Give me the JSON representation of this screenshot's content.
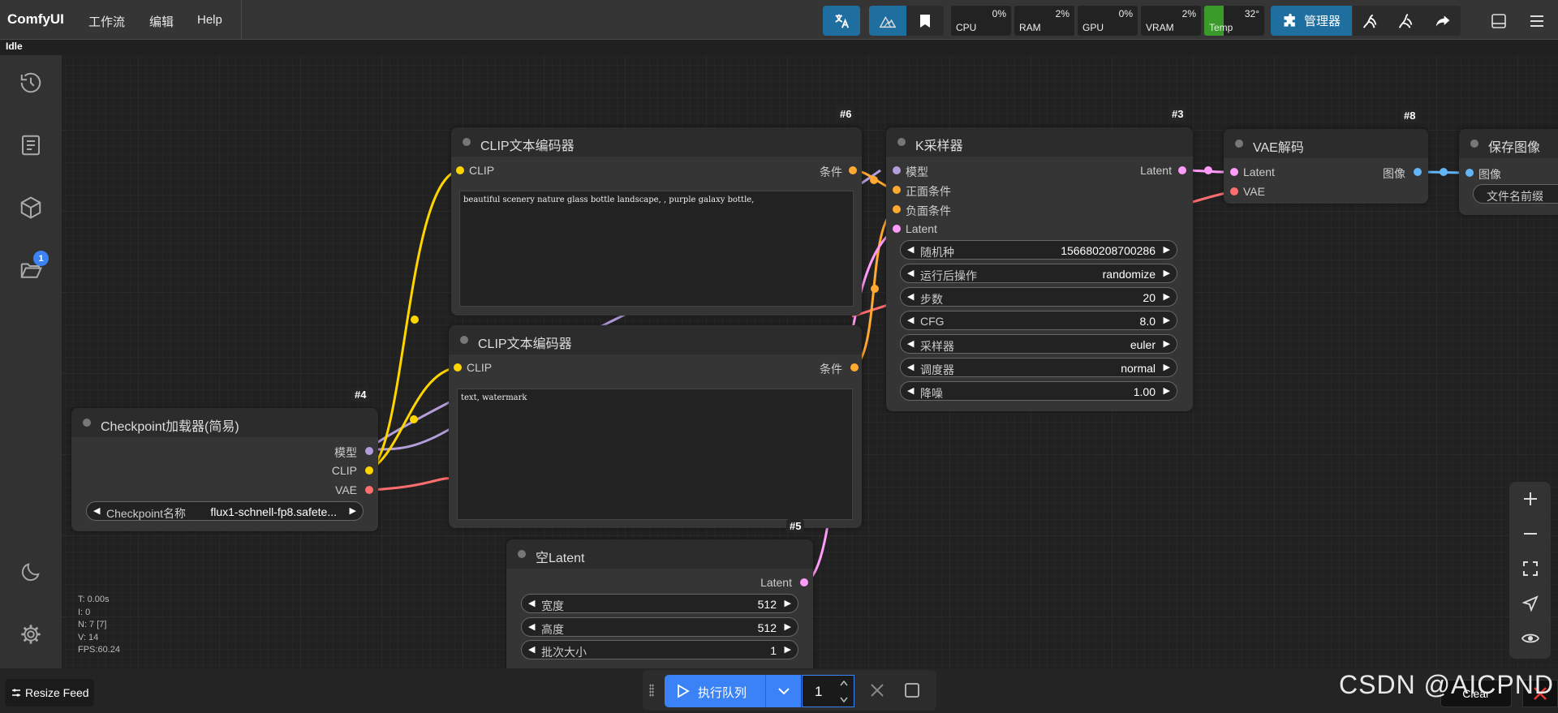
{
  "app": {
    "brand": "ComfyUI",
    "status": "Idle"
  },
  "menu": {
    "workflow": "工作流",
    "edit": "编辑",
    "help": "Help"
  },
  "monitors": [
    {
      "label": "CPU",
      "value": "0%"
    },
    {
      "label": "RAM",
      "value": "2%"
    },
    {
      "label": "GPU",
      "value": "0%"
    },
    {
      "label": "VRAM",
      "value": "2%"
    },
    {
      "label": "Temp",
      "value": "32°"
    }
  ],
  "toolbar": {
    "manager_label": "管理器"
  },
  "sidebar": {
    "queue_badge": "1"
  },
  "nodes": {
    "clip_pos": {
      "id": "#6",
      "title": "CLIP文本编码器",
      "input": "CLIP",
      "output": "条件",
      "text": "beautiful scenery nature glass bottle landscape, , purple galaxy bottle,"
    },
    "clip_neg": {
      "id": "",
      "title": "CLIP文本编码器",
      "input": "CLIP",
      "output": "条件",
      "text": "text, watermark"
    },
    "ksampler": {
      "id": "#3",
      "title": "K采样器",
      "output": "Latent",
      "inputs": [
        "模型",
        "正面条件",
        "负面条件",
        "Latent"
      ],
      "widgets": [
        {
          "label": "随机种",
          "value": "156680208700286"
        },
        {
          "label": "运行后操作",
          "value": "randomize"
        },
        {
          "label": "步数",
          "value": "20"
        },
        {
          "label": "CFG",
          "value": "8.0"
        },
        {
          "label": "采样器",
          "value": "euler"
        },
        {
          "label": "调度器",
          "value": "normal"
        },
        {
          "label": "降噪",
          "value": "1.00"
        }
      ]
    },
    "vae_decode": {
      "id": "#8",
      "title": "VAE解码",
      "inputs": [
        "Latent",
        "VAE"
      ],
      "output": "图像"
    },
    "save_image": {
      "title": "保存图像",
      "input": "图像",
      "widget": "文件名前缀"
    },
    "checkpoint": {
      "id": "#4",
      "title": "Checkpoint加载器(简易)",
      "outputs": [
        "模型",
        "CLIP",
        "VAE"
      ],
      "widget": {
        "label": "Checkpoint名称",
        "value": "flux1-schnell-fp8.safete..."
      }
    },
    "empty_latent": {
      "id": "#5",
      "title": "空Latent",
      "output": "Latent",
      "widgets": [
        {
          "label": "宽度",
          "value": "512"
        },
        {
          "label": "高度",
          "value": "512"
        },
        {
          "label": "批次大小",
          "value": "1"
        }
      ]
    }
  },
  "stats": {
    "t": "T: 0.00s",
    "i": "I: 0",
    "n": "N: 7 [7]",
    "v": "V: 14",
    "fps": "FPS:60.24"
  },
  "bottom": {
    "resize_feed": "Resize Feed",
    "run_label": "执行队列",
    "batch_count": "1",
    "clear": "Clear"
  },
  "watermark": "CSDN @AICPND",
  "colors": {
    "clip": "#ffd500",
    "model": "#b39ddb",
    "vae": "#ff6e6e",
    "conditioning": "#ffa931",
    "latent": "#ff9cf9",
    "image": "#64b5f6",
    "accent": "#3b82f6"
  }
}
